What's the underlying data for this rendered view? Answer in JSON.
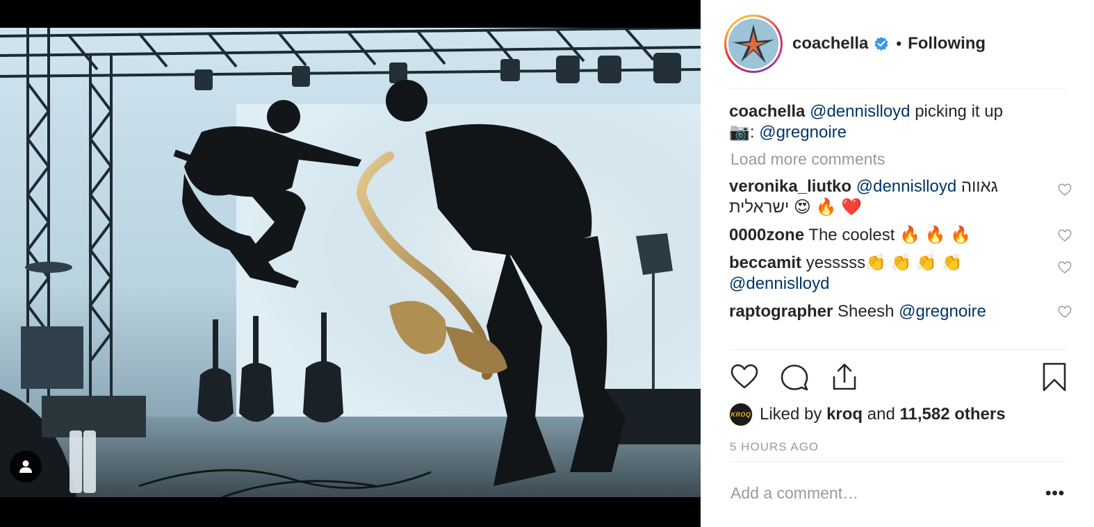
{
  "post": {
    "username": "coachella",
    "separator": "•",
    "follow_state": "Following",
    "caption": {
      "user": "coachella",
      "mention": "@dennislloyd",
      "text": " picking it up",
      "credit_prefix": "📷: ",
      "credit_mention": "@gregnoire"
    },
    "load_more": "Load more comments",
    "comments": [
      {
        "user": "veronika_liutko",
        "mention": "@dennislloyd",
        "text": " גאווה",
        "line2": "ישראלית 😍 🔥 ❤️"
      },
      {
        "user": "0000zone",
        "text": " The coolest 🔥 🔥 🔥"
      },
      {
        "user": "beccamit",
        "text": " yesssss👏 👏 👏 👏",
        "mention_line2": "@dennislloyd"
      },
      {
        "user": "raptographer",
        "text": " Sheesh ",
        "mention": "@gregnoire"
      }
    ],
    "likes": {
      "prefix": "Liked by ",
      "first_liker": "kroq",
      "middle": " and ",
      "count": "11,582 others",
      "liker_avatar_text": "KROQ"
    },
    "timestamp": "5 HOURS AGO",
    "add_comment_placeholder": "Add a comment…",
    "more_label": "•••"
  },
  "icons": {
    "verified": "verified-badge-icon",
    "like": "heart-icon",
    "comment": "comment-bubble-icon",
    "share": "share-icon",
    "save": "bookmark-icon",
    "tag": "person-icon",
    "comment_like": "heart-outline-icon"
  },
  "colors": {
    "text": "#262626",
    "mention": "#003569",
    "muted": "#999999",
    "verified": "#3897f0",
    "divider": "#efefef"
  }
}
